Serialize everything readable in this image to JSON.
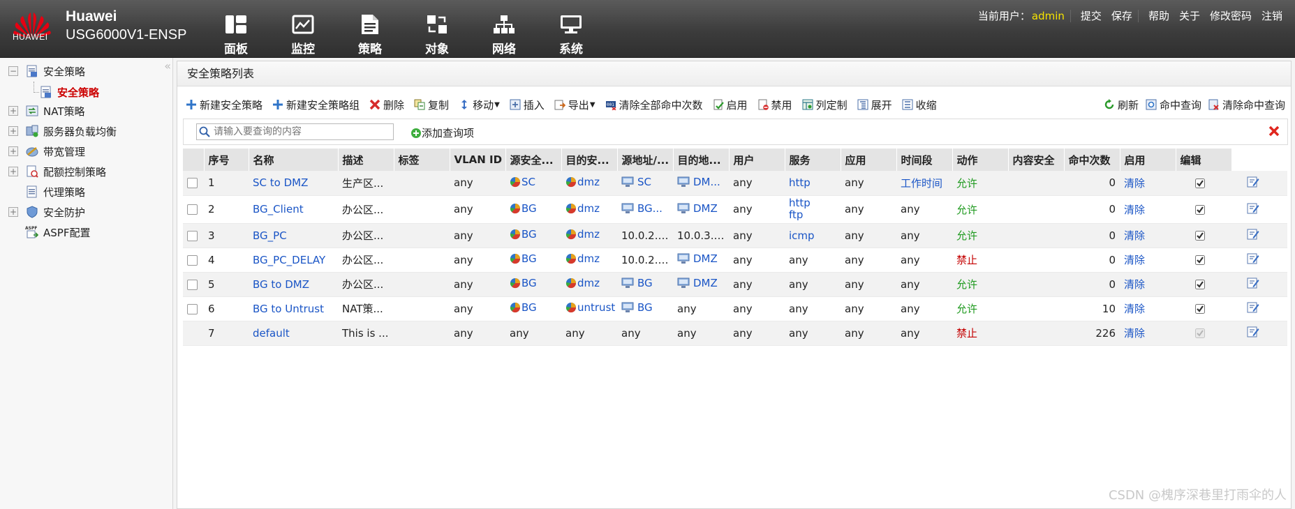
{
  "header": {
    "brand": "Huawei",
    "model": "USG6000V1-ENSP",
    "logo_text": "HUAWEI",
    "nav": [
      {
        "label": "面板",
        "icon": "dashboard-icon"
      },
      {
        "label": "监控",
        "icon": "monitor-icon"
      },
      {
        "label": "策略",
        "icon": "policy-icon"
      },
      {
        "label": "对象",
        "icon": "object-icon"
      },
      {
        "label": "网络",
        "icon": "network-icon"
      },
      {
        "label": "系统",
        "icon": "system-icon"
      }
    ],
    "user_label": "当前用户：",
    "user_name": "admin",
    "links": [
      "提交",
      "保存",
      "帮助",
      "关于",
      "修改密码",
      "注销"
    ]
  },
  "sidebar": {
    "items": [
      {
        "label": "安全策略",
        "expander": "−"
      },
      {
        "label": "安全策略"
      },
      {
        "label": "NAT策略",
        "expander": "+"
      },
      {
        "label": "服务器负载均衡",
        "expander": "+"
      },
      {
        "label": "带宽管理",
        "expander": "+"
      },
      {
        "label": "配额控制策略",
        "expander": "+"
      },
      {
        "label": "代理策略"
      },
      {
        "label": "安全防护",
        "expander": "+"
      },
      {
        "label": "ASPF配置"
      }
    ],
    "aspf_icon_text": "ASPF"
  },
  "main": {
    "title": "安全策略列表",
    "toolbar": {
      "new_policy": "新建安全策略",
      "new_group": "新建安全策略组",
      "delete": "删除",
      "copy": "复制",
      "move": "移动",
      "insert": "插入",
      "export": "导出",
      "clear_all_hits": "清除全部命中次数",
      "enable": "启用",
      "disable": "禁用",
      "customize_columns": "列定制",
      "expand": "展开",
      "collapse": "收缩",
      "refresh": "刷新",
      "hit_query": "命中查询",
      "clear_hit_query": "清除命中查询"
    },
    "search": {
      "placeholder": "请输入要查询的内容",
      "add_query": "添加查询项"
    },
    "columns": [
      "序号",
      "名称",
      "描述",
      "标签",
      "VLAN ID",
      "源安全...",
      "目的安...",
      "源地址/...",
      "目的地...",
      "用户",
      "服务",
      "应用",
      "时间段",
      "动作",
      "内容安全",
      "命中次数",
      "启用",
      "编辑"
    ],
    "rows": [
      {
        "id": "1",
        "name": "SC to DMZ",
        "desc": "生产区...",
        "tag": "",
        "vlan": "any",
        "src_zone": "SC",
        "dst_zone": "dmz",
        "src_addr": "SC",
        "dst_addr": "DM...",
        "user": "any",
        "service": "http",
        "service2": "",
        "app": "any",
        "time": "工作时间",
        "action": "允许",
        "content": "",
        "hits": "0",
        "clear": "清除"
      },
      {
        "id": "2",
        "name": "BG_Client",
        "desc": "办公区...",
        "tag": "",
        "vlan": "any",
        "src_zone": "BG",
        "dst_zone": "dmz",
        "src_addr": "BG...",
        "dst_addr": "DMZ",
        "user": "any",
        "service": "http",
        "service2": "ftp",
        "app": "any",
        "time": "any",
        "action": "允许",
        "content": "",
        "hits": "0",
        "clear": "清除"
      },
      {
        "id": "3",
        "name": "BG_PC",
        "desc": "办公区...",
        "tag": "",
        "vlan": "any",
        "src_zone": "BG",
        "dst_zone": "dmz",
        "src_addr": "10.0.2.1...",
        "dst_addr": "10.0.3.1...",
        "user": "any",
        "service": "icmp",
        "service2": "",
        "app": "any",
        "time": "any",
        "action": "允许",
        "content": "",
        "hits": "0",
        "clear": "清除"
      },
      {
        "id": "4",
        "name": "BG_PC_DELAY",
        "desc": "办公区...",
        "tag": "",
        "vlan": "any",
        "src_zone": "BG",
        "dst_zone": "dmz",
        "src_addr": "10.0.2.1...",
        "dst_addr": "DMZ",
        "user": "any",
        "service": "any",
        "service2": "",
        "app": "any",
        "time": "any",
        "action": "禁止",
        "content": "",
        "hits": "0",
        "clear": "清除"
      },
      {
        "id": "5",
        "name": "BG to DMZ",
        "desc": "办公区...",
        "tag": "",
        "vlan": "any",
        "src_zone": "BG",
        "dst_zone": "dmz",
        "src_addr": "BG",
        "dst_addr": "DMZ",
        "user": "any",
        "service": "any",
        "service2": "",
        "app": "any",
        "time": "any",
        "action": "允许",
        "content": "",
        "hits": "0",
        "clear": "清除"
      },
      {
        "id": "6",
        "name": "BG to Untrust",
        "desc": "NAT策...",
        "tag": "",
        "vlan": "any",
        "src_zone": "BG",
        "dst_zone": "untrust",
        "src_addr": "BG",
        "dst_addr": "any",
        "user": "any",
        "service": "any",
        "service2": "",
        "app": "any",
        "time": "any",
        "action": "允许",
        "content": "",
        "hits": "10",
        "clear": "清除"
      },
      {
        "id": "7",
        "name": "default",
        "desc": "This is ...",
        "tag": "",
        "vlan": "any",
        "src_zone": "any",
        "dst_zone": "any",
        "src_addr": "any",
        "dst_addr": "any",
        "user": "any",
        "service": "any",
        "service2": "",
        "app": "any",
        "time": "any",
        "action": "禁止",
        "content": "",
        "hits": "226",
        "clear": "清除"
      }
    ]
  },
  "watermark": "CSDN @槐序深巷里打雨伞的人",
  "colors": {
    "allow": "#1f9a1f",
    "deny": "#c40000",
    "link": "#1a55c6",
    "user": "#f5e300"
  }
}
